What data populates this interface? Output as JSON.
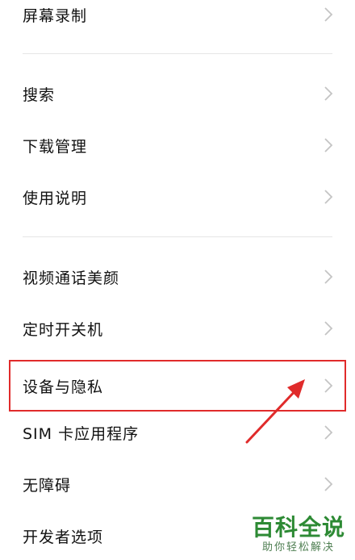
{
  "items": [
    {
      "label": "屏幕录制"
    },
    {
      "label": "搜索"
    },
    {
      "label": "下载管理"
    },
    {
      "label": "使用说明"
    },
    {
      "label": "视频通话美颜"
    },
    {
      "label": "定时开关机"
    },
    {
      "label": "设备与隐私"
    },
    {
      "label": "SIM 卡应用程序"
    },
    {
      "label": "无障碍"
    },
    {
      "label": "开发者选项"
    }
  ],
  "highlight_color": "#e02b2b",
  "chevron_icon": "chevron-right-icon",
  "watermark": {
    "title": "百科全说",
    "subtitle": "助你轻松解决"
  }
}
